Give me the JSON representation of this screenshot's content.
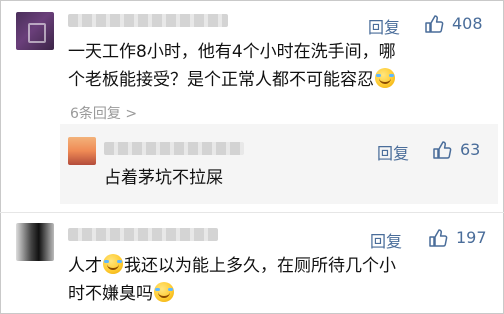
{
  "comments": [
    {
      "reply_label": "回复",
      "likes": "408",
      "text_line1": "一天工作8小时，他有4个小时在洗手间，哪",
      "text_line2": "个老板能接受？是个正常人都不可能容忍",
      "more_replies": "6条回复 >"
    },
    {
      "reply_label": "回复",
      "likes": "63",
      "text": "占着茅坑不拉屎"
    },
    {
      "reply_label": "回复",
      "likes": "197",
      "text_line1a": "人才",
      "text_line1b": "我还以为能上多久，在厕所待几个小",
      "text_line2": "时不嫌臭吗"
    }
  ],
  "icons": {
    "like": "thumbs-up-icon",
    "emoji": "laughing-tears-emoji"
  },
  "colors": {
    "action": "#4a6d9a",
    "text": "#111111",
    "muted": "#9a9a9a",
    "reply_bg": "#f5f5f5"
  }
}
